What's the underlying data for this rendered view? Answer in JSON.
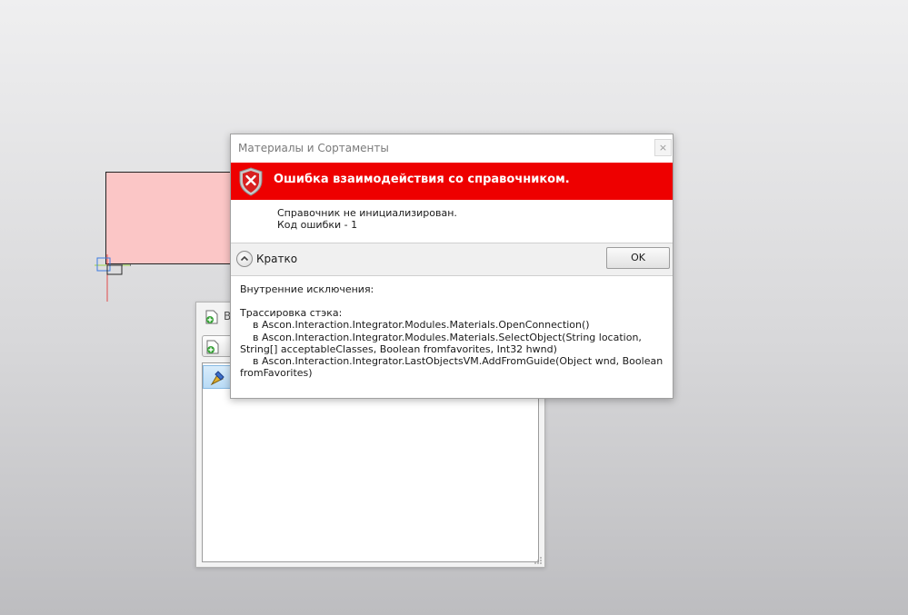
{
  "dialog": {
    "title": "Материалы и Сортаменты",
    "close_glyph": "×",
    "header": "Ошибка взаимодействия со справочником.",
    "message_lines": [
      "Справочник не инициализирован.",
      "Код ошибки - 1"
    ],
    "toggle_label": "Кратко",
    "ok_label": "OK",
    "details": {
      "inner_exceptions": "Внутренние исключения:",
      "stack_title": "Трассировка стэка:",
      "stack_lines": [
        "    в Ascon.Interaction.Integrator.Modules.Materials.OpenConnection()",
        "    в Ascon.Interaction.Integrator.Modules.Materials.SelectObject(String location, String[] acceptableClasses, Boolean fromfavorites, Int32 hwnd)",
        "    в Ascon.Interaction.Integrator.LastObjectsVM.AddFromGuide(Object wnd, Boolean fromFavorites)"
      ]
    },
    "colors": {
      "banner": "#ee0000",
      "header_text": "#ffffff"
    },
    "icons": {
      "header": "error-shield-icon",
      "toggle": "chevron-up-icon"
    }
  },
  "background_window": {
    "title_partial": "В",
    "icons": [
      "add-document-icon",
      "add-document-icon",
      "material-paint-icon"
    ]
  },
  "canvas": {
    "shape_fill": "#fbc6c6"
  }
}
